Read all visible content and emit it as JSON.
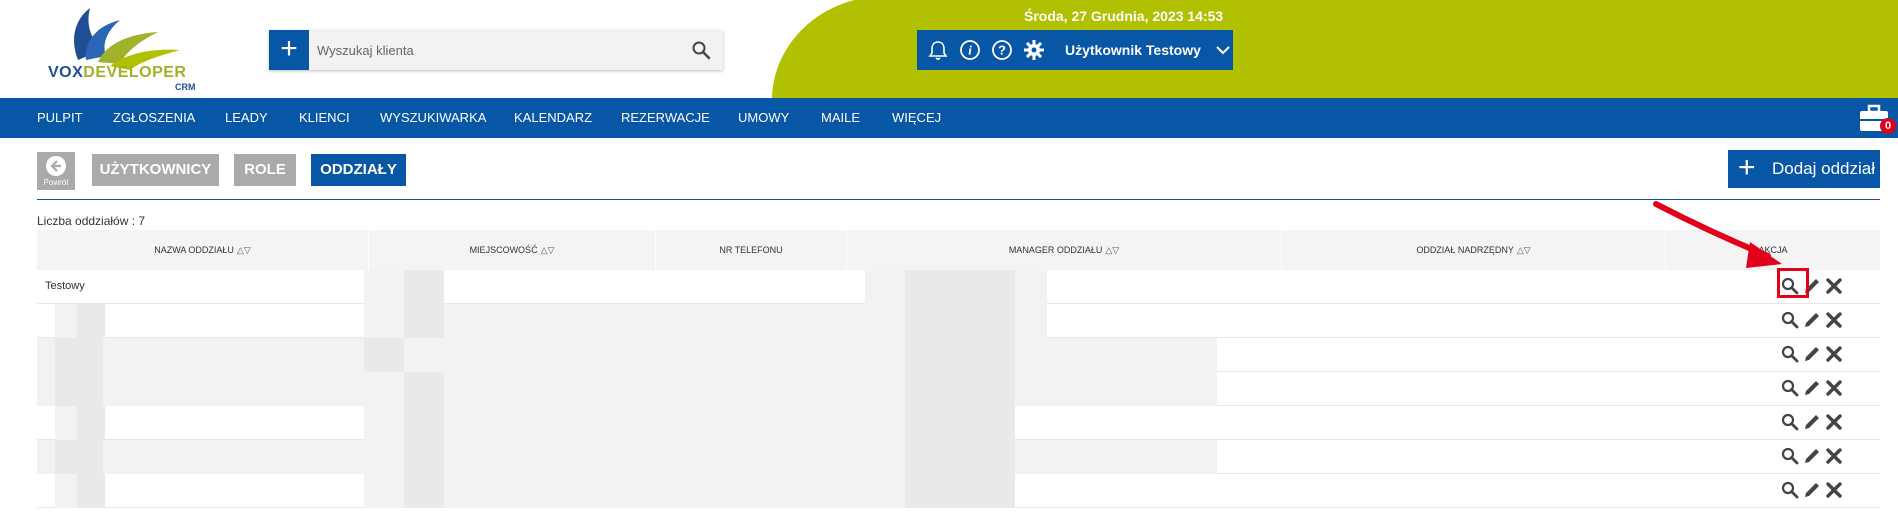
{
  "header": {
    "logo_text_a": "VOX",
    "logo_text_b": "DEVELOPER",
    "logo_sub": "CRM",
    "search": {
      "placeholder": "Wyszukaj klienta",
      "value": ""
    },
    "datetime": "Środa, 27 Grudnia, 2023   14:53",
    "user_name": "Użytkownik Testowy",
    "icons": [
      "bell-icon",
      "info-icon",
      "help-icon",
      "gear-icon",
      "chevron-down-icon"
    ]
  },
  "nav": {
    "items": [
      "PULPIT",
      "ZGŁOSZENIA",
      "LEADY",
      "KLIENCI",
      "WYSZUKIWARKA",
      "KALENDARZ",
      "REZERWACJE",
      "UMOWY",
      "MAILE",
      "WIĘCEJ"
    ],
    "briefcase_count": "0"
  },
  "toolbar": {
    "back_label": "Powrót",
    "tabs": [
      "UŻYTKOWNICY",
      "ROLE",
      "ODDZIAŁY"
    ],
    "active_tab": "ODDZIAŁY",
    "add_label": "Dodaj oddział"
  },
  "table": {
    "count_label": "Liczba oddziałów : 7",
    "columns": [
      "NAZWA ODDZIAŁU",
      "MIEJSCOWOŚĆ",
      "NR TELEFONU",
      "MANAGER ODDZIAŁU",
      "ODDZIAŁ NADRZĘDNY",
      "AKCJA"
    ],
    "sortable": [
      true,
      true,
      false,
      true,
      true,
      false
    ],
    "rows": [
      {
        "name": "Testowy"
      },
      {
        "name": ""
      },
      {
        "name": ""
      },
      {
        "name": ""
      },
      {
        "name": ""
      },
      {
        "name": ""
      },
      {
        "name": ""
      }
    ],
    "row_actions": [
      "search-icon",
      "pencil-icon",
      "close-icon"
    ]
  },
  "colors": {
    "brand_blue": "#0857a6",
    "brand_green": "#b1c000",
    "highlight_red": "#e3001b",
    "tab_inactive": "#aaaaaa"
  }
}
